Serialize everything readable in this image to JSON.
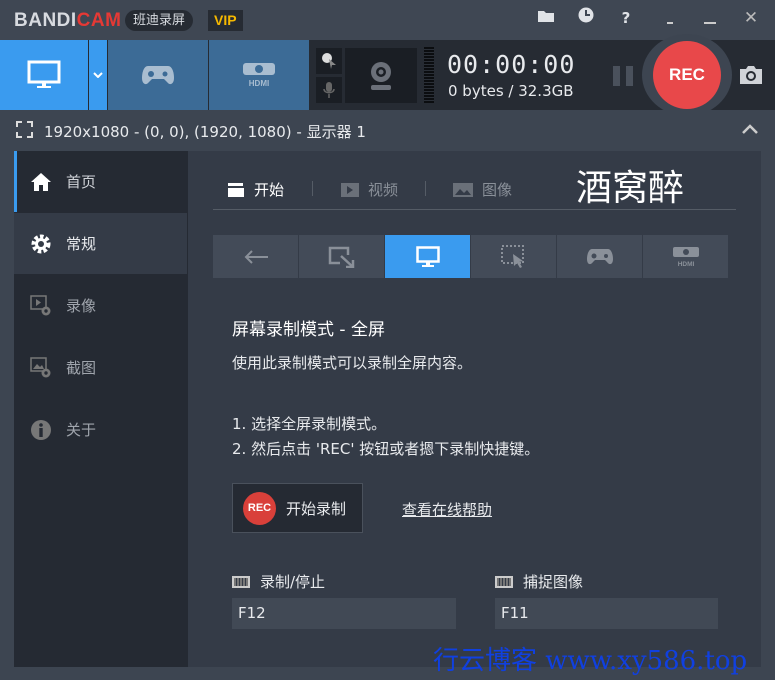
{
  "titlebar": {
    "logo_a": "BANDI",
    "logo_b": "CAM",
    "brand": "班迪录屏",
    "vip": "VIP",
    "buttons": [
      "folder-icon",
      "clock-icon",
      "help-icon",
      "minimize-to-tray",
      "minimize",
      "close"
    ],
    "help": "?",
    "close": "✕"
  },
  "toolbar": {
    "timer": "00:00:00",
    "size": "0 bytes / 32.3GB",
    "rec": "REC"
  },
  "infobar": {
    "area": "1920x1080 - (0, 0), (1920, 1080) - 显示器 1"
  },
  "sidebar": {
    "items": [
      {
        "label": "首页"
      },
      {
        "label": "常规"
      },
      {
        "label": "录像"
      },
      {
        "label": "截图"
      },
      {
        "label": "关于"
      }
    ]
  },
  "main": {
    "tabs": [
      {
        "label": "开始"
      },
      {
        "label": "视频"
      },
      {
        "label": "图像"
      }
    ],
    "heading_overlay": "酒窝醉",
    "title": "屏幕录制模式 - 全屏",
    "desc": "使用此录制模式可以录制全屏内容。",
    "step1": "1. 选择全屏录制模式。",
    "step2": "2. 然后点击 'REC' 按钮或者摁下录制快捷键。",
    "start_rec": "开始录制",
    "rec_badge": "REC",
    "help_link": "查看在线帮助",
    "hotkey1_label": "录制/停止",
    "hotkey1_value": "F12",
    "hotkey2_label": "捕捉图像",
    "hotkey2_value": "F11"
  },
  "watermark": "行云博客 www.xy586.top",
  "colors": {
    "accent": "#3a9bef",
    "rec": "#e8484a",
    "bg": "#343b47",
    "sidebar": "#252a33"
  }
}
